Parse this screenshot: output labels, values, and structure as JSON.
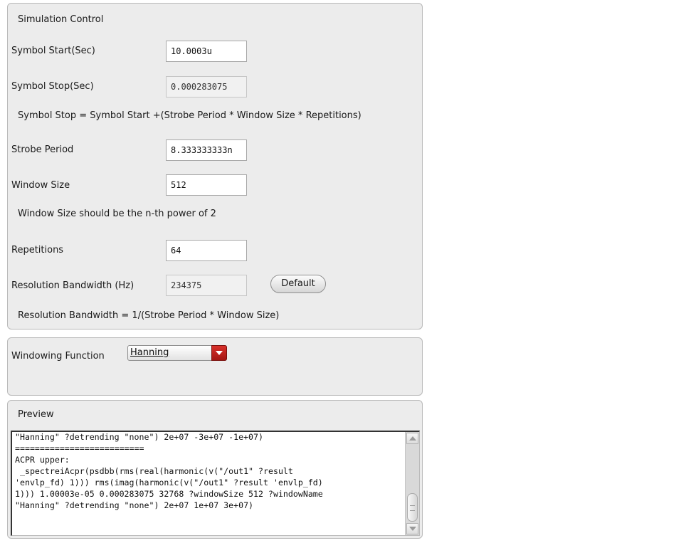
{
  "simulation": {
    "title": "Simulation Control",
    "symbol_start": {
      "label": "Symbol Start(Sec)",
      "value": "10.0003u"
    },
    "symbol_stop": {
      "label": "Symbol Stop(Sec)",
      "value": "0.000283075"
    },
    "stop_formula": "Symbol Stop = Symbol Start +(Strobe Period * Window Size * Repetitions)",
    "strobe_period": {
      "label": "Strobe Period",
      "value": "8.333333333n"
    },
    "window_size": {
      "label": "Window Size",
      "value": "512"
    },
    "window_note": "Window Size should be the n-th power of 2",
    "repetitions": {
      "label": "Repetitions",
      "value": "64"
    },
    "resolution_bandwidth": {
      "label": "Resolution Bandwidth (Hz)",
      "value": "234375"
    },
    "default_button": "Default",
    "rbw_formula": "Resolution Bandwidth = 1/(Strobe Period * Window Size)"
  },
  "windowing": {
    "label": "Windowing Function",
    "selected": "Hanning"
  },
  "preview": {
    "title": "Preview",
    "text": "\"Hanning\" ?detrending \"none\") 2e+07 -3e+07 -1e+07)\n==========================\nACPR upper:\n _spectreiAcpr(psdbb(rms(real(harmonic(v(\"/out1\" ?result\n'envlp_fd) 1))) rms(imag(harmonic(v(\"/out1\" ?result 'envlp_fd)\n1))) 1.00003e-05 0.000283075 32768 ?windowSize 512 ?windowName\n\"Hanning\" ?detrending \"none\") 2e+07 1e+07 3e+07)"
  },
  "colors": {
    "panel_bg": "#ececec",
    "dropdown_arrow": "#c0201a"
  }
}
